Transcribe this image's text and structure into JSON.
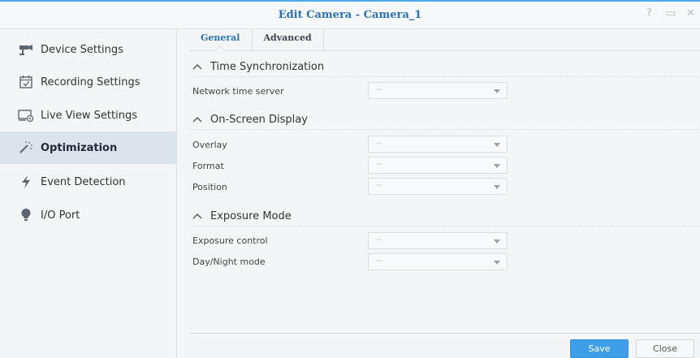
{
  "window": {
    "title": "Edit Camera - Camera_1",
    "controls": {
      "help": "?",
      "maximize": "▭",
      "close": "✕"
    }
  },
  "sidebar": {
    "items": [
      {
        "label": "Device Settings",
        "icon": "camera-icon",
        "active": false
      },
      {
        "label": "Recording Settings",
        "icon": "calendar-check-icon",
        "active": false
      },
      {
        "label": "Live View Settings",
        "icon": "monitor-settings-icon",
        "active": false
      },
      {
        "label": "Optimization",
        "icon": "magic-wand-icon",
        "active": true
      },
      {
        "label": "Event Detection",
        "icon": "lightning-icon",
        "active": false
      },
      {
        "label": "I/O Port",
        "icon": "lightbulb-icon",
        "active": false
      }
    ]
  },
  "tabs": [
    {
      "label": "General",
      "active": true
    },
    {
      "label": "Advanced",
      "active": false
    }
  ],
  "sections": {
    "time_sync": {
      "title": "Time Synchronization",
      "fields": [
        {
          "label": "Network time server",
          "value": "--"
        }
      ]
    },
    "osd": {
      "title": "On-Screen Display",
      "fields": [
        {
          "label": "Overlay",
          "value": "--"
        },
        {
          "label": "Format",
          "value": "--"
        },
        {
          "label": "Position",
          "value": "--"
        }
      ]
    },
    "exposure": {
      "title": "Exposure Mode",
      "fields": [
        {
          "label": "Exposure control",
          "value": "--"
        },
        {
          "label": "Day/Night mode",
          "value": "--"
        }
      ]
    }
  },
  "footer": {
    "save_label": "Save",
    "close_label": "Close"
  },
  "colors": {
    "accent": "#2a72b8",
    "save_button": "#3e9ee8",
    "active_nav": "#dbe4ec"
  }
}
